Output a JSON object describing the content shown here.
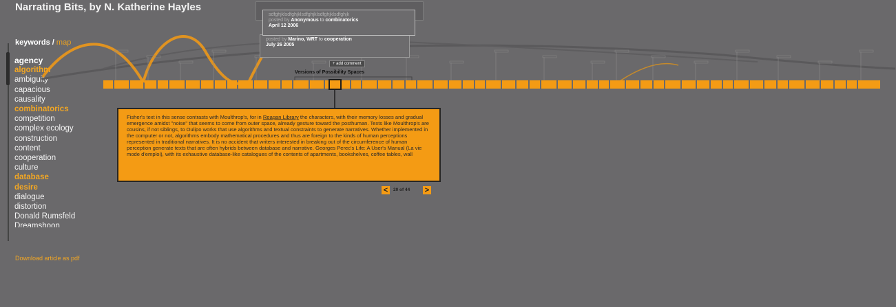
{
  "header": {
    "title": "Narrating Bits, by N. Katherine Hayles"
  },
  "keywords": {
    "label": "keywords /",
    "map_label": "map",
    "items": [
      {
        "label": "agency",
        "state": "selected"
      },
      {
        "label": "algorithm",
        "state": "highlight"
      },
      {
        "label": "ambiguity",
        "state": "normal"
      },
      {
        "label": "capacious",
        "state": "normal"
      },
      {
        "label": "causality",
        "state": "normal"
      },
      {
        "label": "combinatorics",
        "state": "highlight"
      },
      {
        "label": "competition",
        "state": "normal"
      },
      {
        "label": "complex ecology",
        "state": "normal"
      },
      {
        "label": "construction",
        "state": "normal"
      },
      {
        "label": "content",
        "state": "normal"
      },
      {
        "label": "cooperation",
        "state": "normal"
      },
      {
        "label": "culture",
        "state": "normal"
      },
      {
        "label": "database",
        "state": "highlight"
      },
      {
        "label": "desire",
        "state": "highlight"
      },
      {
        "label": "dialogue",
        "state": "normal"
      },
      {
        "label": "distortion",
        "state": "normal"
      },
      {
        "label": "Donald Rumsfeld",
        "state": "normal"
      },
      {
        "label": "Dreamshoon",
        "state": "normal"
      }
    ]
  },
  "download_link": "Download article as pdf",
  "comment_top": {
    "text": "sdfghjklsdfghjklsdfghjklsdfghjklsdfghjk",
    "posted_prefix": "posted by",
    "author": "Anonymous",
    "to": "to",
    "target": "combinatorics",
    "date": "April 12 2006"
  },
  "comment_bottom": {
    "posted_prefix": "posted by",
    "author": "Marino, WRT",
    "to": "to",
    "target": "cooperation",
    "date": "July 26 2005"
  },
  "add_comment": "+ add comment",
  "versions_label": "Versions of Possibility Spaces",
  "paragraph": {
    "before": "Fisher's text in this sense contrasts with Moulthrop's, for in ",
    "link": "Reagan Library",
    "after": " the characters, with their memory losses and gradual emergence amidst \"noise\" that seems to come from outer space, already gesture toward the posthuman. Texts like Moulthrop's are cousins, if not siblings, to Oulipo works that use algorithms and textual constraints to generate narratives. Whether implemented in the computer or not, algorithms embody mathematical procedures and thus are foreign to the kinds of human perceptions represented in traditional narratives. It is no accident that writers interested in breaking out of the circumference of human perception generate texts that are often hybrids between database and narrative. Georges Perec's Life: A User's Manual (La vie mode d'emploi), with its exhaustive database-like catalogues of the contents of apartments, bookshelves, coffee tables, wall"
  },
  "pager": {
    "prev": "<",
    "count": "20 of 44",
    "next": ">"
  },
  "colors": {
    "accent": "#f49b14",
    "background": "#6a696b"
  }
}
